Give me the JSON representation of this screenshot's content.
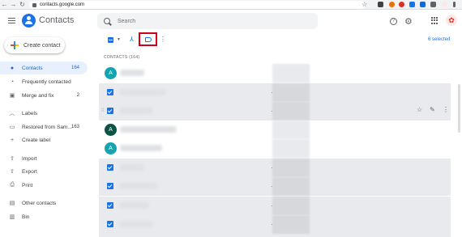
{
  "browser": {
    "url": "contacts.google.com"
  },
  "app": {
    "title": "Contacts"
  },
  "search": {
    "placeholder": "Search"
  },
  "account": {
    "avatar_glyph": "✿"
  },
  "sidebar": {
    "create_label": "Create contact",
    "items": [
      {
        "label": "Contacts",
        "count": "164",
        "icon": "person-icon"
      },
      {
        "label": "Frequently contacted",
        "count": "",
        "icon": "history-icon"
      },
      {
        "label": "Merge and fix",
        "count": "2",
        "icon": "merge-fix-icon"
      },
      {
        "label": "Labels",
        "count": "",
        "icon": "chevron-up-icon"
      },
      {
        "label": "Restored from Sam...",
        "count": "163",
        "icon": "label-icon"
      },
      {
        "label": "Create label",
        "count": "",
        "icon": "plus-icon"
      },
      {
        "label": "Import",
        "count": "",
        "icon": "import-icon"
      },
      {
        "label": "Export",
        "count": "",
        "icon": "export-icon"
      },
      {
        "label": "Print",
        "count": "",
        "icon": "print-icon"
      },
      {
        "label": "Other contacts",
        "count": "",
        "icon": "other-contacts-icon"
      },
      {
        "label": "Bin",
        "count": "",
        "icon": "bin-icon"
      }
    ]
  },
  "toolbar": {
    "selected_text": "6 selected"
  },
  "list": {
    "section_header": "CONTACTS (164)",
    "rows": [
      {
        "type": "avatar",
        "initial": "A",
        "color": "#12a4af"
      },
      {
        "type": "check"
      },
      {
        "type": "check"
      },
      {
        "type": "avatar",
        "initial": "A",
        "color": "#0b5345"
      },
      {
        "type": "avatar",
        "initial": "A",
        "color": "#12a4af"
      },
      {
        "type": "check"
      },
      {
        "type": "check"
      },
      {
        "type": "check"
      },
      {
        "type": "check"
      }
    ]
  },
  "colors": {
    "accent": "#1a73e8",
    "highlight_box": "#d0021b",
    "selected_row": "#e8eaed"
  }
}
